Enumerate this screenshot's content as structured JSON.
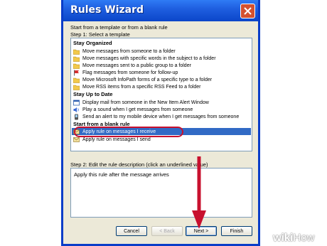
{
  "window": {
    "title": "Rules Wizard",
    "intro": "Start from a template or from a blank rule",
    "step1_label": "Step 1: Select a template",
    "step2_label": "Step 2: Edit the rule description (click an underlined value)",
    "description": "Apply this rule after the message arrives"
  },
  "sections": [
    {
      "title": "Stay Organized",
      "items": [
        {
          "label": "Move messages from someone to a folder",
          "icon": "folder-icon"
        },
        {
          "label": "Move messages with specific words in the subject to a folder",
          "icon": "folder-icon"
        },
        {
          "label": "Move messages sent to a public group to a folder",
          "icon": "folder-icon"
        },
        {
          "label": "Flag messages from someone for follow-up",
          "icon": "flag-icon"
        },
        {
          "label": "Move Microsoft InfoPath forms of a specific type to a folder",
          "icon": "folder-icon"
        },
        {
          "label": "Move RSS items from a specific RSS Feed to a folder",
          "icon": "folder-icon"
        }
      ]
    },
    {
      "title": "Stay Up to Date",
      "items": [
        {
          "label": "Display mail from someone in the New Item Alert Window",
          "icon": "window-icon"
        },
        {
          "label": "Play a sound when I get messages from someone",
          "icon": "sound-icon"
        },
        {
          "label": "Send an alert to my mobile device when I get messages from someone",
          "icon": "mobile-icon"
        }
      ]
    },
    {
      "title": "Start from a blank rule",
      "items": [
        {
          "label": "Apply rule on messages I receive",
          "icon": "envelope-icon",
          "selected": true
        },
        {
          "label": "Apply rule on messages I send",
          "icon": "envelope-icon"
        }
      ]
    }
  ],
  "buttons": {
    "cancel": "Cancel",
    "back": "< Back",
    "next": "Next >",
    "finish": "Finish"
  },
  "watermark": {
    "wiki": "wiki",
    "how": "How"
  },
  "colors": {
    "title_bar": "#0b46c9",
    "selection": "#316ac5",
    "annotation": "#c8102e",
    "dialog_bg": "#ece9d8"
  }
}
